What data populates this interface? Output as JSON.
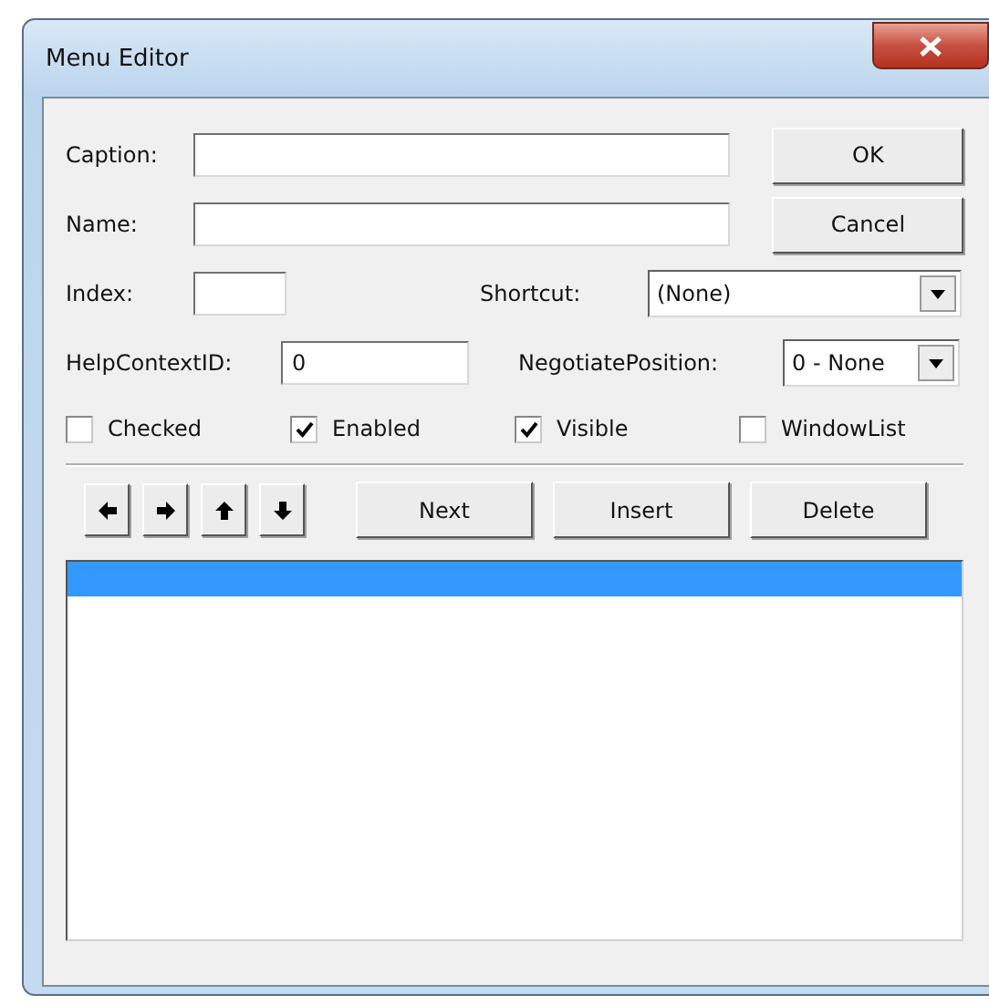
{
  "window": {
    "title": "Menu Editor"
  },
  "fields": {
    "caption": {
      "label": "Caption:"
    },
    "name": {
      "label": "Name:"
    },
    "index": {
      "label": "Index:"
    },
    "shortcut": {
      "label": "Shortcut:",
      "value": "(None)"
    },
    "help_context_id": {
      "label": "HelpContextID:",
      "value": "0"
    },
    "negotiate_position": {
      "label": "NegotiatePosition:",
      "value": "0 - None"
    }
  },
  "buttons": {
    "ok": "OK",
    "cancel": "Cancel"
  },
  "checkboxes": [
    {
      "label": "Checked",
      "checked": false
    },
    {
      "label": "Enabled",
      "checked": true
    },
    {
      "label": "Visible",
      "checked": true
    },
    {
      "label": "WindowList",
      "checked": false
    }
  ],
  "arrow_buttons": [
    {
      "kind": "left"
    },
    {
      "kind": "right"
    },
    {
      "kind": "up"
    },
    {
      "kind": "down"
    }
  ],
  "action_buttons": [
    "Next",
    "Insert",
    "Delete"
  ],
  "menu_list": {
    "items": [
      {
        "selected": true
      }
    ]
  }
}
